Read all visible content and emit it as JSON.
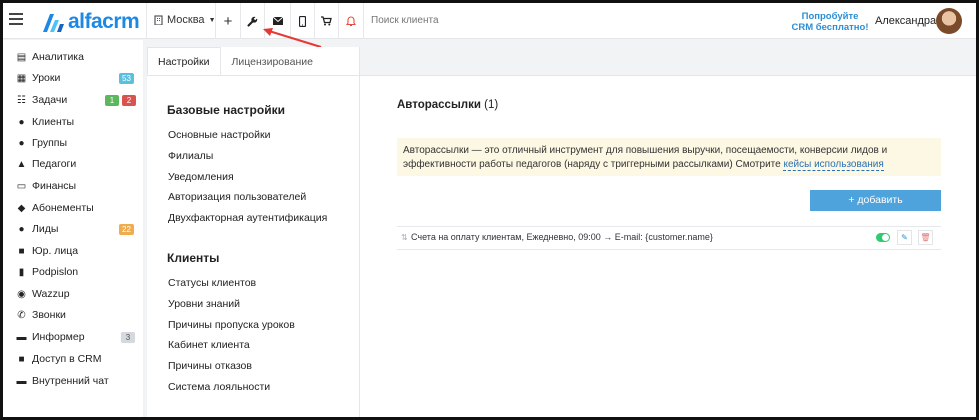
{
  "topbar": {
    "logo_text": "alfacrm",
    "city": "Москва",
    "search_placeholder": "Поиск клиента",
    "promo_line1": "Попробуйте",
    "promo_line2": "CRM бесплатно!",
    "username": "Александра",
    "colors": {
      "brand": "#1e88e5",
      "bell": "#e74c3c",
      "promo": "#2a8fd6"
    },
    "icons": [
      "menu-icon",
      "plus-icon",
      "wrench-icon",
      "mail-icon",
      "phone-icon",
      "cart-icon",
      "bell-icon"
    ]
  },
  "sidebar": {
    "items": [
      {
        "label": "Аналитика",
        "icon": "chart-icon"
      },
      {
        "label": "Уроки",
        "icon": "calendar-icon",
        "badges": [
          "53"
        ]
      },
      {
        "label": "Задачи",
        "icon": "tasks-icon",
        "badges": [
          "1",
          "2"
        ]
      },
      {
        "label": "Клиенты",
        "icon": "user-icon"
      },
      {
        "label": "Группы",
        "icon": "group-icon"
      },
      {
        "label": "Педагоги",
        "icon": "graduation-cap-icon"
      },
      {
        "label": "Финансы",
        "icon": "money-icon"
      },
      {
        "label": "Абонементы",
        "icon": "tag-icon"
      },
      {
        "label": "Лиды",
        "icon": "leads-icon",
        "badges": [
          "22"
        ]
      },
      {
        "label": "Юр. лица",
        "icon": "briefcase-icon"
      },
      {
        "label": "Podpislon",
        "icon": "document-icon"
      },
      {
        "label": "Wazzup",
        "icon": "whatsapp-icon"
      },
      {
        "label": "Звонки",
        "icon": "phone-icon"
      },
      {
        "label": "Информер",
        "icon": "informer-icon",
        "badges": [
          "3"
        ]
      },
      {
        "label": "Доступ в CRM",
        "icon": "lock-icon"
      },
      {
        "label": "Внутренний чат",
        "icon": "chat-icon"
      }
    ],
    "badge_colors": {
      "teal": "#5bc0de",
      "green": "#5cb85c",
      "red": "#d9534f",
      "orange": "#f0ad4e",
      "gray": "#d5d8dc"
    }
  },
  "tabs": [
    "Настройки",
    "Лицензирование"
  ],
  "settings": {
    "group1_title": "Базовые настройки",
    "group1_links": [
      "Основные настройки",
      "Филиалы",
      "Уведомления",
      "Авторизация пользователей",
      "Двухфакторная аутентификация"
    ],
    "group2_title": "Клиенты",
    "group2_links": [
      "Статусы клиентов",
      "Уровни знаний",
      "Причины пропуска уроков",
      "Кабинет клиента",
      "Причины отказов",
      "Система лояльности"
    ]
  },
  "main": {
    "title": "Авторассылки",
    "count": "(1)",
    "info_text": "Авторассылки — это отличный инструмент для повышения выручки, посещаемости, конверсии лидов и эффективности работы педагогов (наряду с триггерными рассылками) Смотрите",
    "info_link": "кейсы использования",
    "add_button": "+ добавить",
    "row_text": "Счета на оплату клиентам, Ежедневно, 09:00 → E-mail: {customer.name}",
    "row_enabled": true
  }
}
